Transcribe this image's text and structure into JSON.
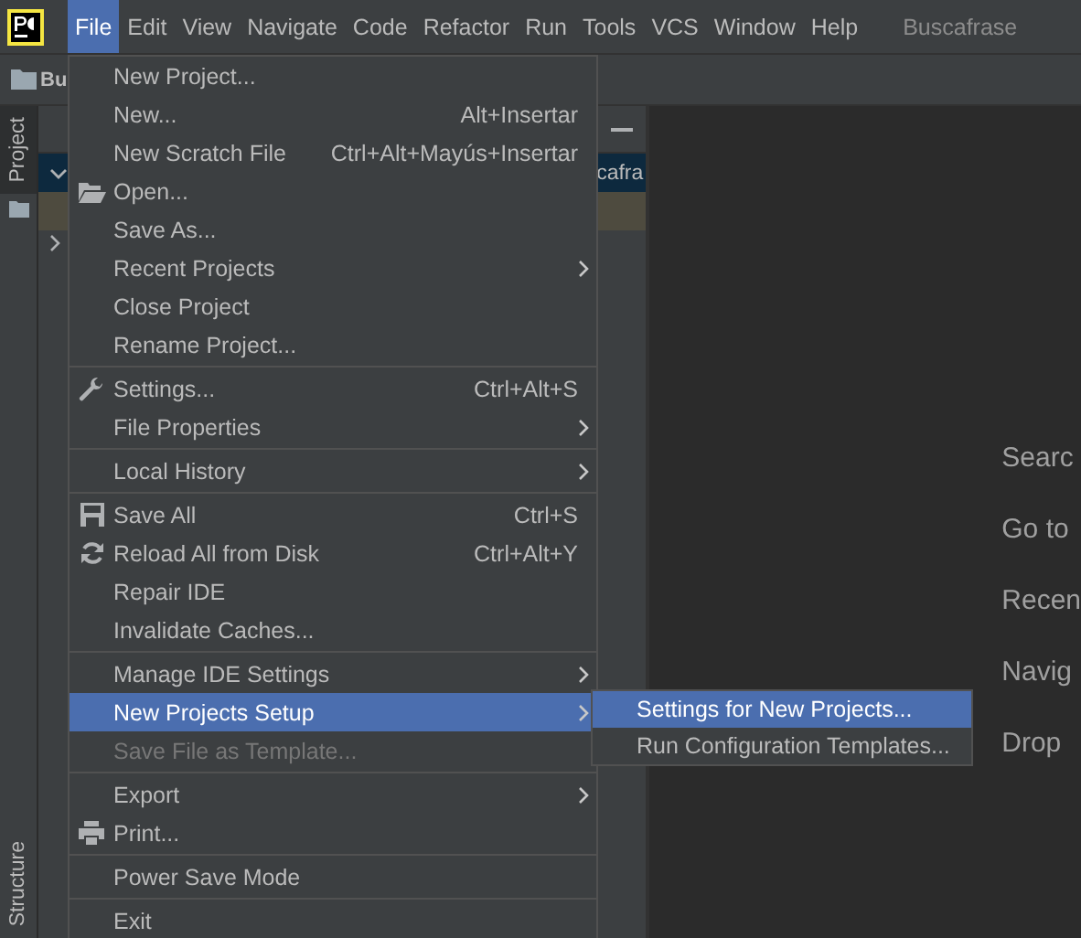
{
  "menu_bar": {
    "items": [
      {
        "label": "File",
        "selected": true
      },
      {
        "label": "Edit",
        "selected": false
      },
      {
        "label": "View",
        "selected": false
      },
      {
        "label": "Navigate",
        "selected": false
      },
      {
        "label": "Code",
        "selected": false
      },
      {
        "label": "Refactor",
        "selected": false
      },
      {
        "label": "Run",
        "selected": false
      },
      {
        "label": "Tools",
        "selected": false
      },
      {
        "label": "VCS",
        "selected": false
      },
      {
        "label": "Window",
        "selected": false
      },
      {
        "label": "Help",
        "selected": false
      }
    ],
    "project_title": "Buscafrase"
  },
  "nav_bar": {
    "breadcrumb": "Bu"
  },
  "tool_stripe": {
    "top": [
      {
        "label": "Project",
        "selected": true
      }
    ],
    "bottom": [
      {
        "label": "Structure",
        "selected": false
      }
    ]
  },
  "project_panel": {
    "selected_row_text": "cafra"
  },
  "file_menu": [
    {
      "kind": "plain",
      "label": "New Project...",
      "submenu": false,
      "disabled": false,
      "selected": false
    },
    {
      "kind": "plain",
      "label": "New...",
      "shortcut": "Alt+Insertar",
      "submenu": false,
      "disabled": false,
      "selected": false
    },
    {
      "kind": "plain",
      "label": "New Scratch File",
      "shortcut": "Ctrl+Alt+Mayús+Insertar",
      "submenu": false,
      "disabled": false,
      "selected": false
    },
    {
      "kind": "folder",
      "label": "Open...",
      "submenu": false,
      "disabled": false,
      "selected": false
    },
    {
      "kind": "plain",
      "label": "Save As...",
      "submenu": false,
      "disabled": false,
      "selected": false
    },
    {
      "kind": "plain",
      "label": "Recent Projects",
      "submenu": true,
      "disabled": false,
      "selected": false
    },
    {
      "kind": "plain",
      "label": "Close Project",
      "submenu": false,
      "disabled": false,
      "selected": false
    },
    {
      "kind": "plain",
      "label": "Rename Project...",
      "submenu": false,
      "disabled": false,
      "selected": false
    },
    {
      "kind": "separator"
    },
    {
      "kind": "wrench",
      "label": "Settings...",
      "shortcut": "Ctrl+Alt+S",
      "submenu": false,
      "disabled": false,
      "selected": false
    },
    {
      "kind": "plain",
      "label": "File Properties",
      "submenu": true,
      "disabled": false,
      "selected": false
    },
    {
      "kind": "separator"
    },
    {
      "kind": "plain",
      "label": "Local History",
      "submenu": true,
      "disabled": false,
      "selected": false
    },
    {
      "kind": "separator"
    },
    {
      "kind": "disk",
      "label": "Save All",
      "shortcut": "Ctrl+S",
      "submenu": false,
      "disabled": false,
      "selected": false
    },
    {
      "kind": "reload",
      "label": "Reload All from Disk",
      "shortcut": "Ctrl+Alt+Y",
      "submenu": false,
      "disabled": false,
      "selected": false
    },
    {
      "kind": "plain",
      "label": "Repair IDE",
      "submenu": false,
      "disabled": false,
      "selected": false
    },
    {
      "kind": "plain",
      "label": "Invalidate Caches...",
      "submenu": false,
      "disabled": false,
      "selected": false
    },
    {
      "kind": "separator"
    },
    {
      "kind": "plain",
      "label": "Manage IDE Settings",
      "submenu": true,
      "disabled": false,
      "selected": false
    },
    {
      "kind": "plain",
      "label": "New Projects Setup",
      "submenu": true,
      "disabled": false,
      "selected": true
    },
    {
      "kind": "plain",
      "label": "Save File as Template...",
      "submenu": false,
      "disabled": true,
      "selected": false
    },
    {
      "kind": "separator"
    },
    {
      "kind": "plain",
      "label": "Export",
      "submenu": true,
      "disabled": false,
      "selected": false
    },
    {
      "kind": "printer",
      "label": "Print...",
      "submenu": false,
      "disabled": false,
      "selected": false
    },
    {
      "kind": "separator"
    },
    {
      "kind": "plain",
      "label": "Power Save Mode",
      "submenu": false,
      "disabled": false,
      "selected": false
    },
    {
      "kind": "separator"
    },
    {
      "kind": "plain",
      "label": "Exit",
      "submenu": false,
      "disabled": false,
      "selected": false
    }
  ],
  "submenu": [
    {
      "label": "Settings for New Projects...",
      "selected": true
    },
    {
      "label": "Run Configuration Templates...",
      "selected": false
    }
  ],
  "editor_hints": [
    "Searc",
    "Go to",
    "Recen",
    "Navig",
    "Drop"
  ]
}
